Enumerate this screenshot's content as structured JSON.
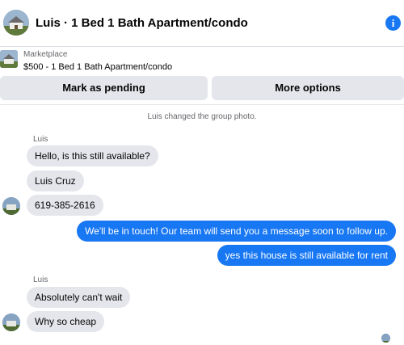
{
  "header": {
    "title": "Luis · 1 Bed 1 Bath Apartment/condo",
    "info_icon": "info-icon",
    "info_glyph": "i",
    "accent": "#1877f2"
  },
  "listing": {
    "kicker": "Marketplace",
    "detail": "$500 - 1 Bed 1 Bath Apartment/condo"
  },
  "actions": {
    "mark_pending": "Mark as pending",
    "more_options": "More options"
  },
  "conversation": {
    "system_notice": "Luis changed the group photo.",
    "group1": {
      "sender": "Luis",
      "messages": [
        "Hello, is this still available?",
        "Luis Cruz",
        "619-385-2616"
      ]
    },
    "outgoing": [
      "We'll be in touch! Our team will send you a message soon to follow up.",
      "yes this house is still available for rent"
    ],
    "group2": {
      "sender": "Luis",
      "messages": [
        "Absolutely can't wait",
        "Why so cheap"
      ]
    }
  }
}
